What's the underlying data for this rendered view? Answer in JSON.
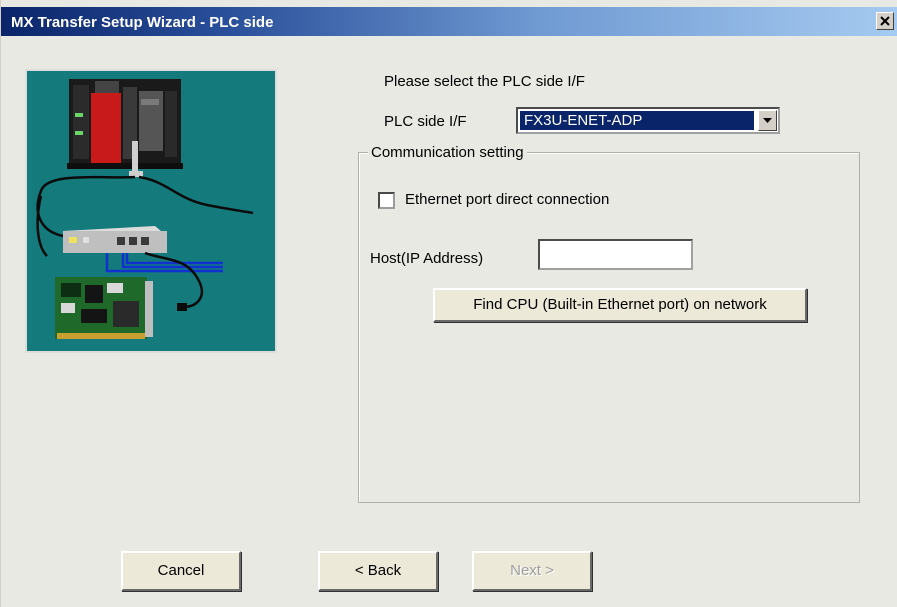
{
  "window": {
    "title": "MX Transfer Setup Wizard - PLC side",
    "close_icon": "close-icon"
  },
  "instruction": "Please select the PLC side I/F",
  "plc_if": {
    "label": "PLC side I/F",
    "selected": "FX3U-ENET-ADP"
  },
  "communication": {
    "legend": "Communication setting",
    "ethernet_direct_label": "Ethernet port direct connection",
    "ethernet_direct_checked": false,
    "host_label": "Host(IP Address)",
    "host_value": "",
    "find_cpu_label": "Find CPU (Built-in Ethernet port) on network"
  },
  "footer": {
    "cancel_label": "Cancel",
    "back_label": "< Back",
    "next_label": "Next >"
  },
  "colors": {
    "illustration_bg": "#147a7c",
    "selection": "#0a246a",
    "title_start": "#0a246a",
    "title_end": "#a6caf0"
  }
}
